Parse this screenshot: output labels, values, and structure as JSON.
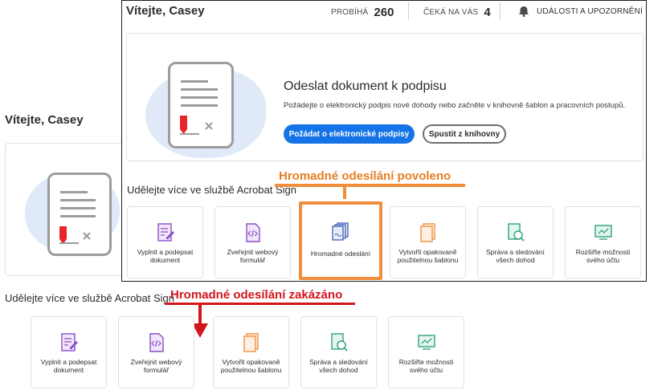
{
  "background_view": {
    "title": "Vítejte, Casey",
    "section_title": "Udělejte více ve službě Acrobat Sign",
    "annotation": "Hromadné odesílání zakázáno",
    "tiles": [
      {
        "label": "Vyplnit a podepsat dokument",
        "icon": "fill-sign-icon",
        "color": "#8b4fc7"
      },
      {
        "label": "Zveřejnit webový formulář",
        "icon": "web-form-icon",
        "color": "#8b4fc7"
      },
      {
        "label": "Vytvořit opakovaně použitelnou šablonu",
        "icon": "template-icon",
        "color": "#ef8f3c"
      },
      {
        "label": "Správa a sledování všech dohod",
        "icon": "manage-agreements-icon",
        "color": "#2fa37a"
      },
      {
        "label": "Rozšiřte možnosti svého účtu",
        "icon": "expand-account-icon",
        "color": "#2fa37a"
      }
    ]
  },
  "foreground_view": {
    "title": "Vítejte, Casey",
    "header": {
      "in_progress_label": "PROBÍHÁ",
      "in_progress_count": "260",
      "waiting_label": "ČEKÁ NA VÁS",
      "waiting_count": "4",
      "events_label": "UDÁLOSTI A UPOZORNĚNÍ"
    },
    "hero": {
      "title": "Odeslat dokument k podpisu",
      "subtitle": "Požádejte o elektronický podpis nové dohody nebo začněte v knihovně šablon a pracovních postupů.",
      "primary_button": "Požádat o elektronické podpisy",
      "secondary_button": "Spustit z knihovny"
    },
    "section_title": "Udělejte více ve službě Acrobat Sign",
    "annotation": "Hromadné odesílání povoleno",
    "tiles": [
      {
        "label": "Vyplnit a podepsat dokument",
        "icon": "fill-sign-icon",
        "color": "#8b4fc7"
      },
      {
        "label": "Zveřejnit webový formulář",
        "icon": "web-form-icon",
        "color": "#8b4fc7"
      },
      {
        "label": "Hromadné odeslání",
        "icon": "bulk-send-icon",
        "color": "#3f5fb4"
      },
      {
        "label": "Vytvořit opakovaně použitelnou šablonu",
        "icon": "template-icon",
        "color": "#ef8f3c"
      },
      {
        "label": "Správa a sledování všech dohod",
        "icon": "manage-agreements-icon",
        "color": "#2fa37a"
      },
      {
        "label": "Rozšiřte možnosti svého účtu",
        "icon": "expand-account-icon",
        "color": "#2fa37a"
      }
    ]
  },
  "colors": {
    "accent_blue": "#1473e6",
    "enabled_annotation": "#e67e22",
    "disabled_annotation": "#d3161c",
    "signature_red": "#e8262a"
  }
}
